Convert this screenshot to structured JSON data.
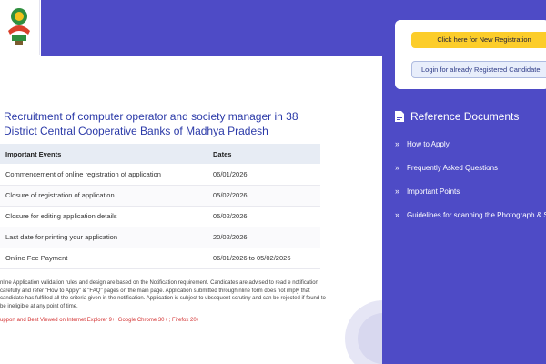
{
  "brand": {
    "logo_icon": "emblem-icon",
    "accent": "#4e4bc6",
    "highlight": "#fccd2a"
  },
  "main": {
    "title": "Recruitment of computer operator and society manager in 38 District Central Cooperative Banks of Madhya Pradesh",
    "table": {
      "headers": [
        "Important Events",
        "Dates"
      ],
      "rows": [
        [
          "Commencement of online registration of application",
          "06/01/2026"
        ],
        [
          "Closure of registration of application",
          "05/02/2026"
        ],
        [
          "Closure for editing application details",
          "05/02/2026"
        ],
        [
          "Last date for printing your application",
          "20/02/2026"
        ],
        [
          "Online Fee Payment",
          "06/01/2026 to 05/02/2026"
        ]
      ]
    },
    "note": "nline Application validation rules and design are based on the Notification requirement. Candidates are advised to read e notification carefully and refer \"How to Apply\" & \"FAQ\" pages on the main page. Application submitted through nline form does not imply that candidate has fulfilled all the criteria given in the notification. Application is subject to ubsequent scrutiny and can be rejected if found to be ineligible at any point of time.",
    "support": "upport and Best Viewed on Internet Explorer 9+; Google Chrome 30+ ; Firefox 20+"
  },
  "login": {
    "new_registration_label": "Click here for New Registration",
    "registered_login_label": "Login for already Registered Candidate"
  },
  "reference": {
    "heading": "Reference Documents",
    "heading_icon": "document-icon",
    "items": [
      {
        "label": "How to Apply",
        "icon": "chevron-double-right-icon"
      },
      {
        "label": "Frequently Asked Questions",
        "icon": "chevron-double-right-icon"
      },
      {
        "label": "Important Points",
        "icon": "chevron-double-right-icon"
      },
      {
        "label": "Guidelines for scanning the Photograph & Signature",
        "icon": "chevron-double-right-icon"
      }
    ]
  }
}
